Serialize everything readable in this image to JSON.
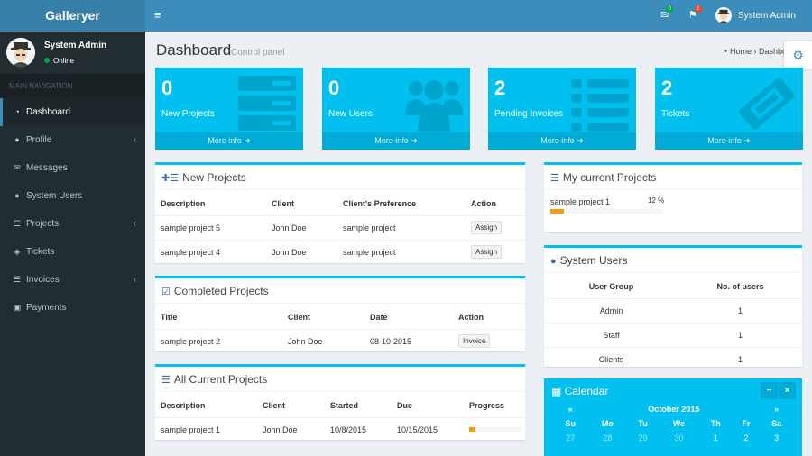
{
  "app": {
    "logo": "Galleryer"
  },
  "user": {
    "name": "System Admin",
    "status": "Online"
  },
  "sidebar": {
    "header": "MAIN NAVIGATION",
    "items": [
      {
        "label": "Dashboard",
        "icon": "dashboard-icon",
        "active": true
      },
      {
        "label": "Profile",
        "icon": "user-icon"
      },
      {
        "label": "Messages",
        "icon": "envelope-icon"
      },
      {
        "label": "System Users",
        "icon": "users-icon"
      },
      {
        "label": "Projects",
        "icon": "list-icon"
      },
      {
        "label": "Tickets",
        "icon": "ticket-icon"
      },
      {
        "label": "Invoices",
        "icon": "list-icon"
      },
      {
        "label": "Payments",
        "icon": "money-icon"
      }
    ]
  },
  "topbar": {
    "mail_count": "0",
    "flag_count": "1",
    "mail_badge_color": "#00a65a",
    "flag_badge_color": "#dd4b39"
  },
  "page": {
    "title": "Dashboard",
    "subtitle": "Control panel",
    "breadcrumb_home": "Home",
    "breadcrumb_current": "Dashboard"
  },
  "stats": [
    {
      "number": "0",
      "label": "New Projects",
      "more": "More info"
    },
    {
      "number": "0",
      "label": "New Users",
      "more": "More info"
    },
    {
      "number": "2",
      "label": "Pending Invoices",
      "more": "More info"
    },
    {
      "number": "2",
      "label": "Tickets",
      "more": "More info"
    }
  ],
  "new_projects": {
    "title": "New Projects",
    "headers": [
      "Description",
      "Client",
      "Client's Preference",
      "Action"
    ],
    "rows": [
      {
        "description": "sample project 5",
        "client": "John Doe",
        "preference": "sample project",
        "action": "Assign"
      },
      {
        "description": "sample project 4",
        "client": "John Doe",
        "preference": "sample project",
        "action": "Assign"
      }
    ]
  },
  "completed_projects": {
    "title": "Completed Projects",
    "headers": [
      "Title",
      "Client",
      "Date",
      "Action"
    ],
    "rows": [
      {
        "title": "sample project 2",
        "client": "John Doe",
        "date": "08-10-2015",
        "action": "Invoice"
      }
    ]
  },
  "all_current_projects": {
    "title": "All Current Projects",
    "headers": [
      "Description",
      "Client",
      "Started",
      "Due",
      "Progress"
    ],
    "rows": [
      {
        "description": "sample project 1",
        "client": "John Doe",
        "started": "10/8/2015",
        "due": "10/15/2015",
        "progress": 0.12
      }
    ]
  },
  "my_projects": {
    "title": "My current Projects",
    "items": [
      {
        "name": "sample project 1",
        "percent_label": "12 %",
        "progress": 0.12
      }
    ]
  },
  "system_users": {
    "title": "System Users",
    "headers": [
      "User Group",
      "No. of users"
    ],
    "rows": [
      {
        "group": "Admin",
        "count": "1"
      },
      {
        "group": "Staff",
        "count": "1"
      },
      {
        "group": "Clients",
        "count": "1"
      }
    ]
  },
  "calendar": {
    "title": "Calendar",
    "month": "October 2015",
    "prev": "«",
    "next": "»",
    "minimize": "−",
    "close": "×",
    "days": [
      "Su",
      "Mo",
      "Tu",
      "We",
      "Th",
      "Fr",
      "Sa"
    ],
    "first_row": [
      "27",
      "28",
      "29",
      "30",
      "1",
      "2",
      "3"
    ]
  },
  "colors": {
    "aqua": "#00c0ef",
    "aqua_dark": "#00acd6",
    "primary": "#3c8dbc",
    "sidebar": "#222d32",
    "progress": "#f39c12"
  }
}
